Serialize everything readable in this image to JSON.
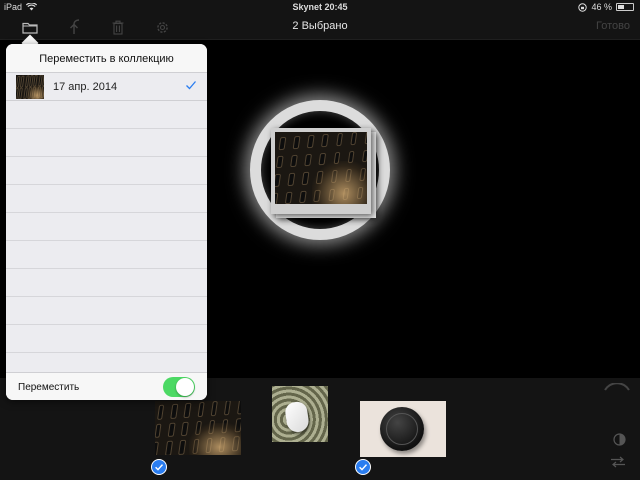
{
  "status_bar": {
    "device": "iPad",
    "carrier": "Skynet",
    "time": "20:45",
    "battery_percent_text": "46 %",
    "battery_level": 0.46
  },
  "nav_bar": {
    "title": "2 Выбрано",
    "done_label": "Готово",
    "tools": [
      "folder-icon",
      "share-icon",
      "trash-icon",
      "gear-icon"
    ]
  },
  "popover": {
    "title": "Переместить в коллекцию",
    "items": [
      {
        "label": "17 апр. 2014",
        "selected": true
      }
    ],
    "footer": {
      "label": "Переместить",
      "toggle_on": true
    }
  },
  "thumbnails": [
    {
      "name": "keyboard-photo",
      "selected": true
    },
    {
      "name": "mouse-photo",
      "selected": false
    },
    {
      "name": "lens-cap-photo",
      "selected": true
    }
  ],
  "colors": {
    "accent_blue": "#2a7df0",
    "toggle_green": "#4cd964",
    "background": "#000000",
    "bars": "#141414"
  }
}
